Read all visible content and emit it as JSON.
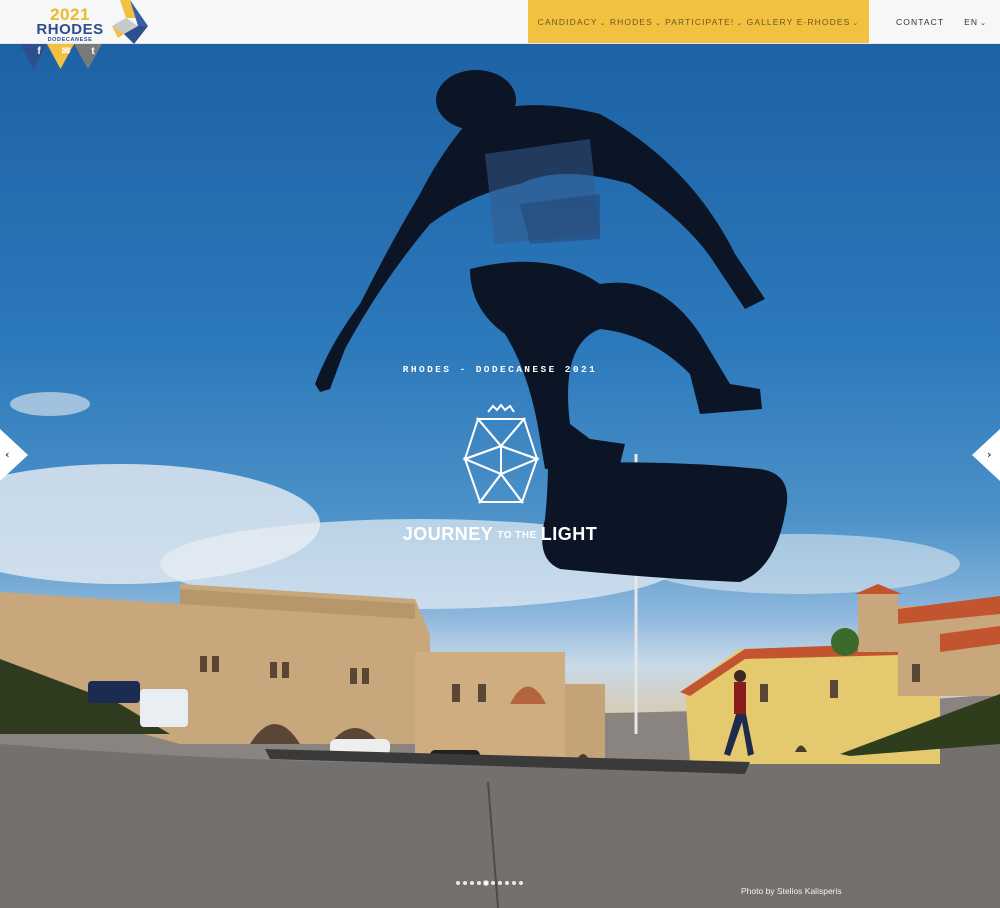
{
  "logo": {
    "year": "2021",
    "city": "RHODES",
    "subtitle": "DODECANESE",
    "social": [
      "f",
      "✉",
      "t"
    ],
    "social_icons": [
      "facebook-icon",
      "mail-icon",
      "twitter-icon"
    ]
  },
  "nav": {
    "items": [
      {
        "label": "CANDIDACY",
        "caret": "⌄"
      },
      {
        "label": "RHODES",
        "caret": "⌄"
      },
      {
        "label": "PARTICIPATE!",
        "caret": "⌄"
      },
      {
        "label": "GALLERY",
        "caret": ""
      },
      {
        "label": "E-RHODES",
        "caret": "⌄"
      }
    ],
    "contact": "CONTACT",
    "language": "EN",
    "language_caret": "⌄"
  },
  "hero": {
    "tagline": "RHODES - DODECANESE 2021",
    "journey_1": "JOURNEY",
    "journey_2": "TO THE",
    "journey_3": "LIGHT",
    "photo_credit": "Photo by Stelios Kalisperis",
    "prev_arrow": "‹",
    "next_arrow": "›",
    "slide_count": 10,
    "active_slide": 5
  },
  "colors": {
    "nav_yellow": "#f2c140",
    "logo_blue": "#2e4e8c",
    "logo_gold": "#e9b92e"
  }
}
